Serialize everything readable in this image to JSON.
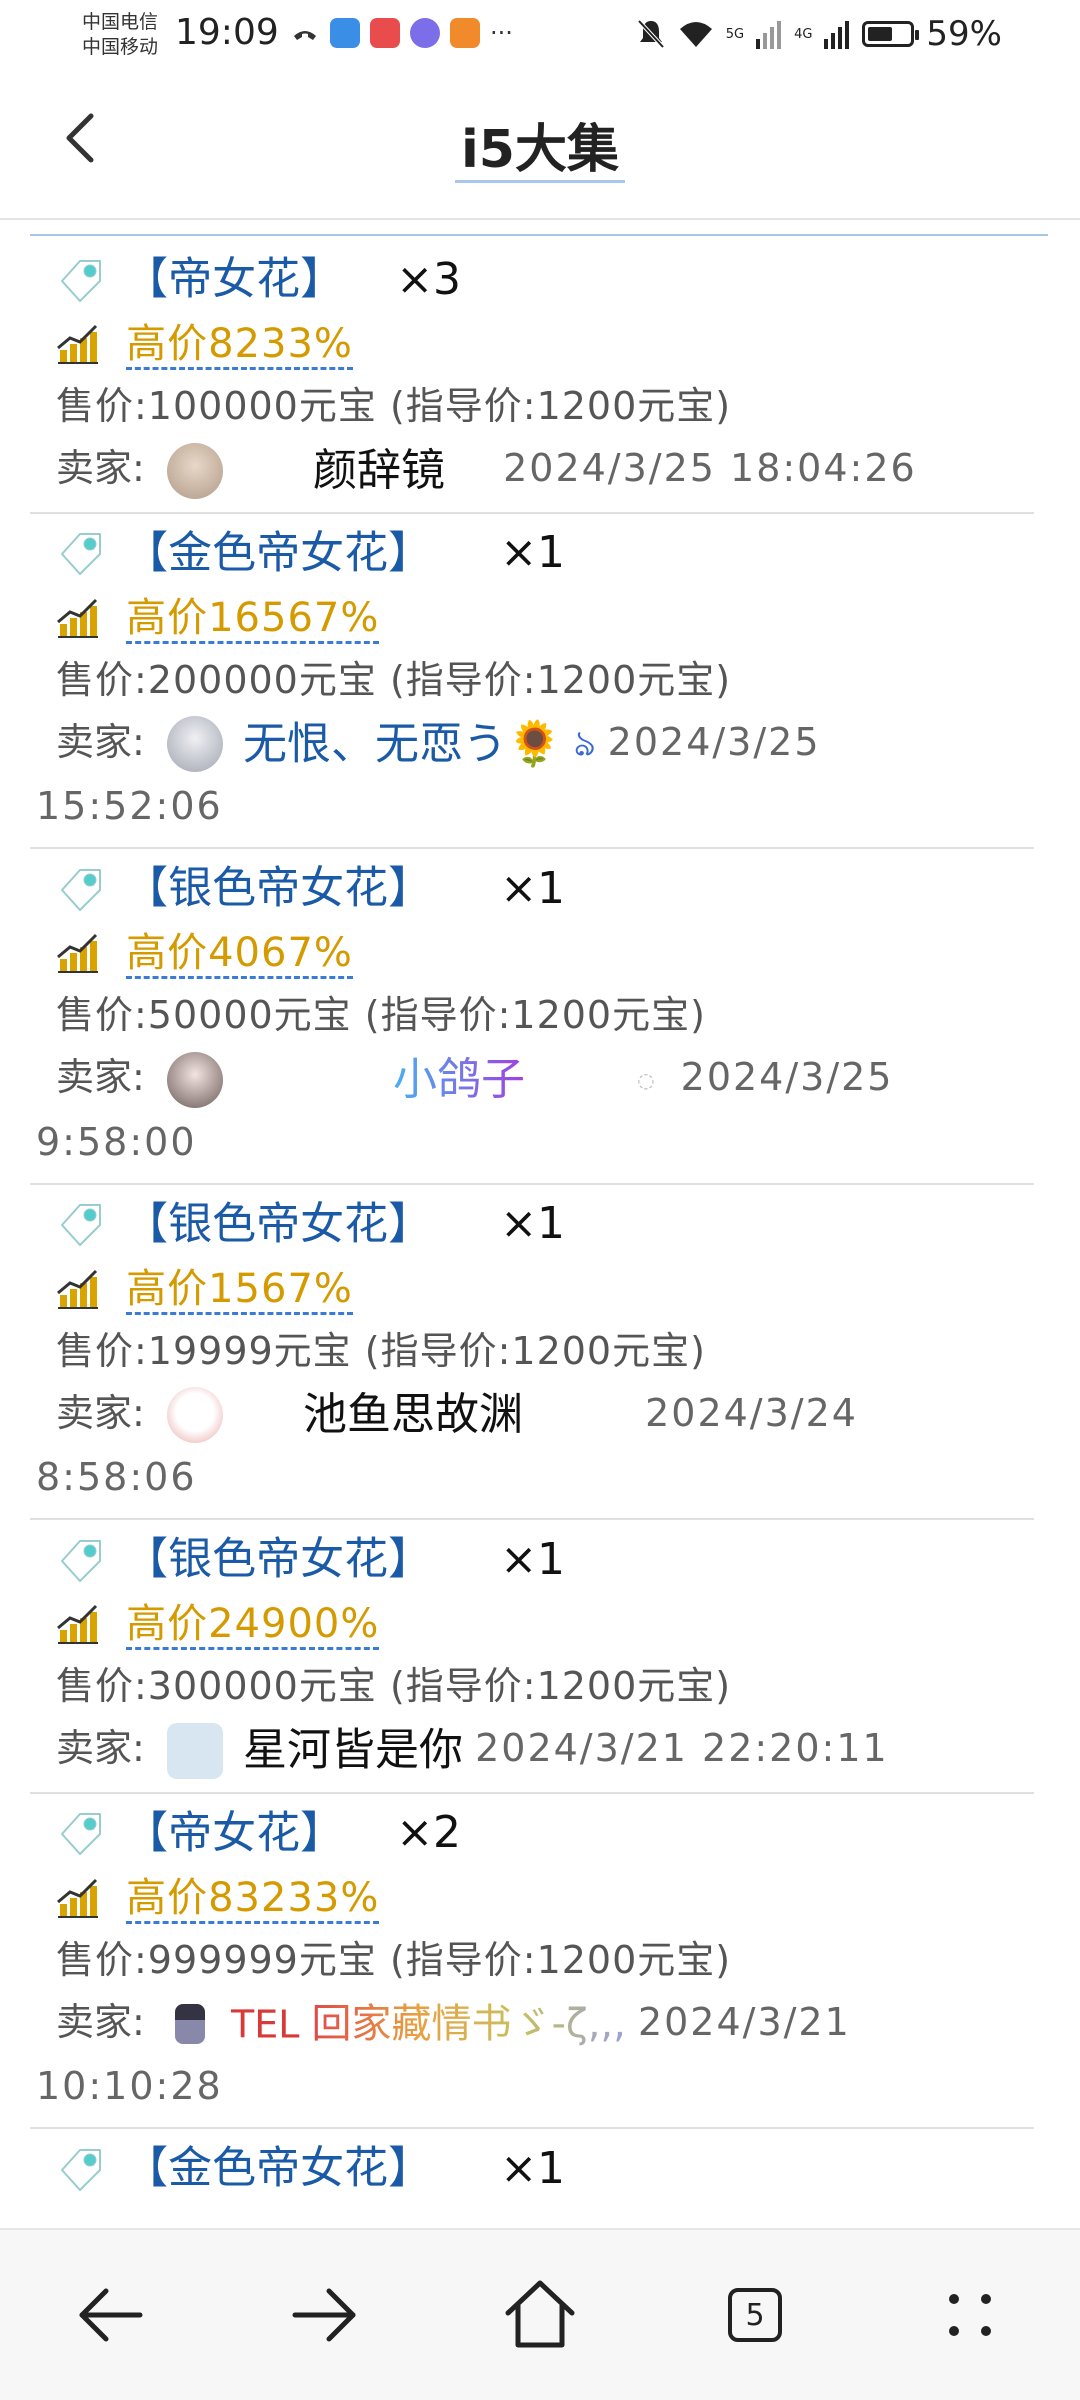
{
  "status_bar": {
    "carrier1": "中国电信",
    "carrier2": "中国移动",
    "time": "19:09",
    "network1": "5G",
    "network2": "4G",
    "battery": "59%",
    "battery_level": 0.59
  },
  "header": {
    "title": "i5大集"
  },
  "listings": [
    {
      "name": "【帝女花】",
      "qty": "×3",
      "premium": "高价8233%",
      "price": "售价:100000元宝 (指导价:1200元宝)",
      "seller_label": "卖家:",
      "seller": "颜辞镜",
      "time": "2024/3/25 18:04:26"
    },
    {
      "name": "【金色帝女花】",
      "qty": "×1",
      "premium": "高价16567%",
      "price": "售价:200000元宝 (指导价:1200元宝)",
      "seller_label": "卖家:",
      "seller": "无恨、无恧う🌻",
      "time": "2024/3/25",
      "time2": "15:52:06"
    },
    {
      "name": "【银色帝女花】",
      "qty": "×1",
      "premium": "高价4067%",
      "price": "售价:50000元宝 (指导价:1200元宝)",
      "seller_label": "卖家:",
      "seller": "小鸽子",
      "time": "2024/3/25",
      "time2": "9:58:00"
    },
    {
      "name": "【银色帝女花】",
      "qty": "×1",
      "premium": "高价1567%",
      "price": "售价:19999元宝 (指导价:1200元宝)",
      "seller_label": "卖家:",
      "seller": "池鱼思故渊",
      "time": "2024/3/24",
      "time2": "8:58:06"
    },
    {
      "name": "【银色帝女花】",
      "qty": "×1",
      "premium": "高价24900%",
      "price": "售价:300000元宝 (指导价:1200元宝)",
      "seller_label": "卖家:",
      "seller": "星河皆是你",
      "time": "2024/3/21 22:20:11"
    },
    {
      "name": "【帝女花】",
      "qty": "×2",
      "premium": "高价83233%",
      "price": "售价:999999元宝 (指导价:1200元宝)",
      "seller_label": "卖家:",
      "seller_prefix": "TEL",
      "seller": "回家藏情书ゞ-ζ,,,",
      "time": "2024/3/21",
      "time2": "10:10:28"
    },
    {
      "name": "【金色帝女花】",
      "qty": "×1"
    }
  ],
  "bottom_nav": {
    "tab_count": "5"
  },
  "colors": {
    "item_name": "#1a5aa6",
    "premium": "#d49a00",
    "accent_border": "#a9c7df"
  }
}
